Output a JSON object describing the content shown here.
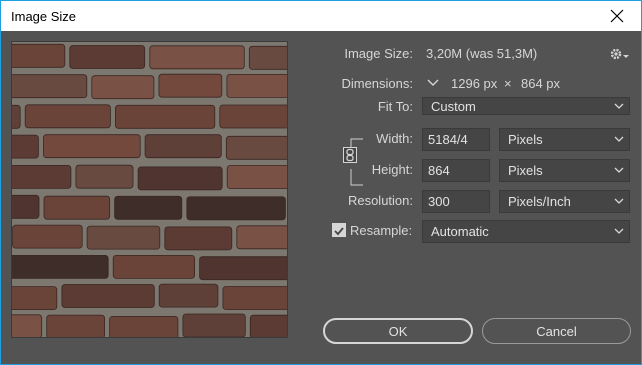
{
  "window": {
    "title": "Image Size"
  },
  "image_size": {
    "label": "Image Size:",
    "value": "3,20M (was 51,3M)"
  },
  "dimensions": {
    "label": "Dimensions:",
    "width": "1296 px",
    "times": "×",
    "height": "864 px"
  },
  "fit_to": {
    "label": "Fit To:",
    "value": "Custom"
  },
  "width": {
    "label": "Width:",
    "value": "5184/4",
    "unit": "Pixels"
  },
  "height": {
    "label": "Height:",
    "value": "864",
    "unit": "Pixels"
  },
  "resolution": {
    "label": "Resolution:",
    "value": "300",
    "unit": "Pixels/Inch"
  },
  "resample": {
    "label": "Resample:",
    "checked": true,
    "value": "Automatic"
  },
  "buttons": {
    "ok": "OK",
    "cancel": "Cancel"
  },
  "icons": {
    "close": "close-icon",
    "settings": "gear-icon",
    "link": "chain-link-icon"
  },
  "colors": {
    "dialog_bg": "#535353",
    "field_bg": "#454545",
    "text": "#d6d6d6",
    "accent_border": "#1ba1e2"
  }
}
